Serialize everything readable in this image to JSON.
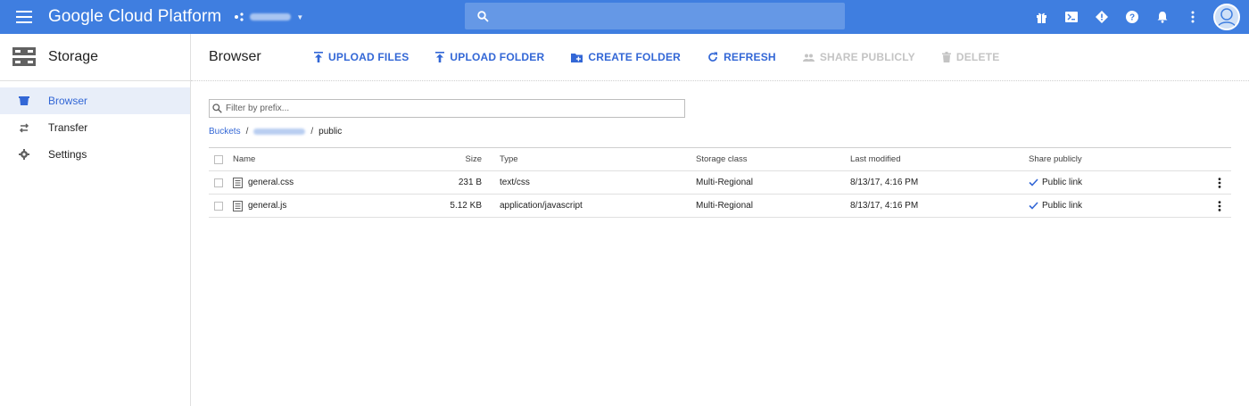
{
  "topbar": {
    "brand": "Google Cloud Platform",
    "icons": [
      "menu-icon",
      "gift-icon",
      "cloud-shell-icon",
      "alert-icon",
      "help-icon",
      "notifications-icon",
      "more-vert-icon"
    ]
  },
  "sidebar": {
    "title": "Storage",
    "items": [
      {
        "label": "Browser",
        "icon": "bucket-icon",
        "active": true
      },
      {
        "label": "Transfer",
        "icon": "transfer-icon",
        "active": false
      },
      {
        "label": "Settings",
        "icon": "gear-icon",
        "active": false
      }
    ]
  },
  "toolbar": {
    "title": "Browser",
    "upload_files": "UPLOAD FILES",
    "upload_folder": "UPLOAD FOLDER",
    "create_folder": "CREATE FOLDER",
    "refresh": "REFRESH",
    "share_publicly": "SHARE PUBLICLY",
    "delete": "DELETE"
  },
  "filter": {
    "placeholder": "Filter by prefix..."
  },
  "breadcrumb": {
    "root": "Buckets",
    "current": "public"
  },
  "table": {
    "headers": {
      "name": "Name",
      "size": "Size",
      "type": "Type",
      "storage_class": "Storage class",
      "last_modified": "Last modified",
      "share": "Share publicly"
    },
    "rows": [
      {
        "name": "general.css",
        "size": "231 B",
        "type": "text/css",
        "storage_class": "Multi-Regional",
        "last_modified": "8/13/17, 4:16 PM",
        "share": "Public link"
      },
      {
        "name": "general.js",
        "size": "5.12 KB",
        "type": "application/javascript",
        "storage_class": "Multi-Regional",
        "last_modified": "8/13/17, 4:16 PM",
        "share": "Public link"
      }
    ]
  },
  "colors": {
    "topbar": "#3f7ee0",
    "accent": "#3367d6",
    "active_nav_bg": "#e8eef9",
    "disabled": "#c4c4c4"
  }
}
